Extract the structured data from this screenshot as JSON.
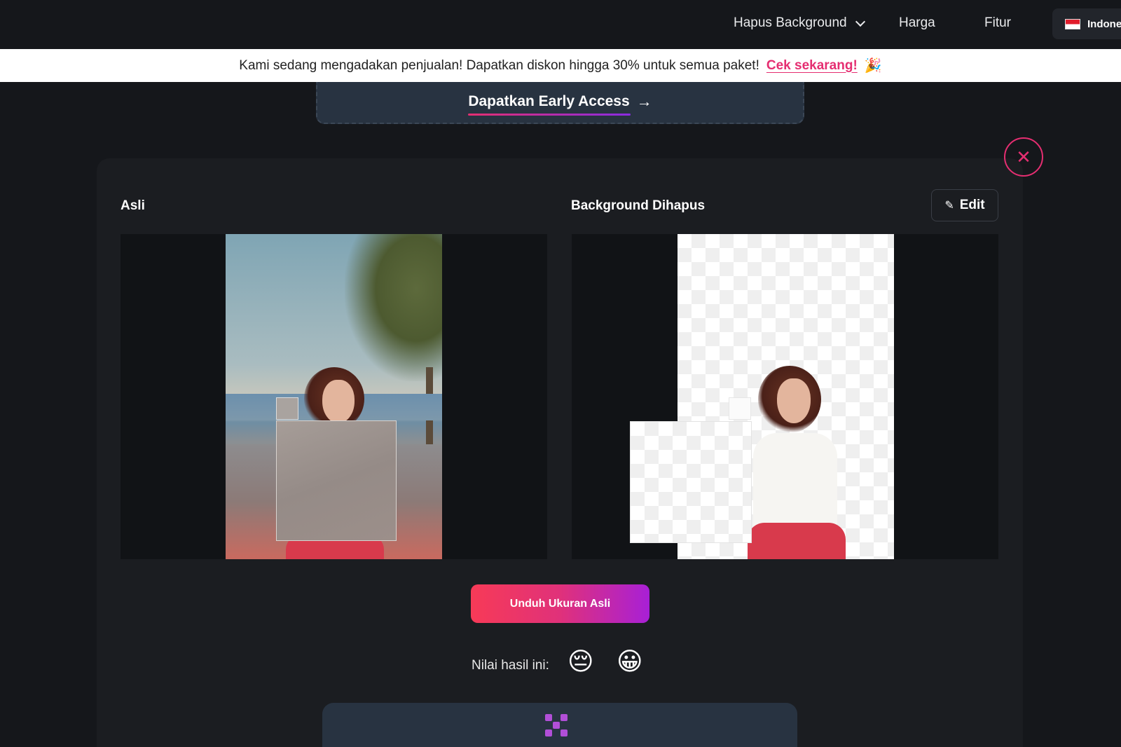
{
  "nav": {
    "hapus_background": "Hapus Background",
    "harga": "Harga",
    "fitur": "Fitur",
    "language": "Indone"
  },
  "banner": {
    "text": "Kami sedang mengadakan penjualan! Dapatkan diskon hingga 30% untuk semua paket!",
    "link": "Cek sekarang!",
    "icon": "party-popper-icon"
  },
  "early_access": {
    "label": "Dapatkan Early Access",
    "arrow": "→"
  },
  "close": {
    "symbol": "✕"
  },
  "panel": {
    "label_original": "Asli",
    "label_removed": "Background Dihapus",
    "edit_label": "Edit",
    "edit_icon": "✎"
  },
  "download": {
    "label": "Unduh Ukuran Asli"
  },
  "rating": {
    "label": "Nilai hasil ini:",
    "sad": "😔",
    "happy": "😀"
  },
  "colors": {
    "accent": "#e52e71",
    "gradient_start": "#f73a57",
    "gradient_end": "#a820d6",
    "card": "#283341",
    "background": "#15171b"
  }
}
